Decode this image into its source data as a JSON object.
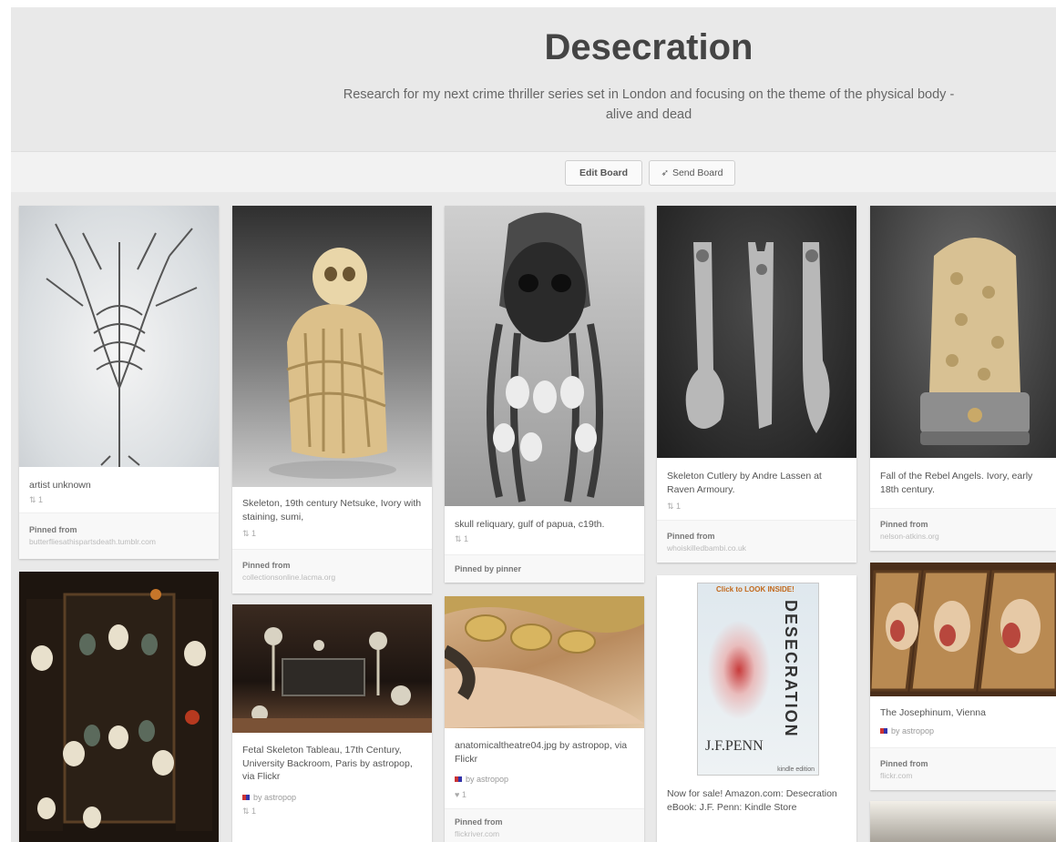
{
  "board": {
    "title": "Desecration",
    "description": "Research for my next crime thriller series set in London and focusing on the theme of the physical body - alive and dead",
    "edit_label": "Edit Board",
    "send_label": "Send Board"
  },
  "pins": [
    {
      "id": "p1",
      "desc": "artist unknown",
      "stats": "⇅ 1",
      "foot_label": "Pinned from",
      "foot_source": "butterfliesathispartsdeath.tumblr.com",
      "image": "tree-ribcage-illustration"
    },
    {
      "id": "p2",
      "desc": "Skeleton, 19th century Netsuke, Ivory with staining, sumi,",
      "stats": "⇅ 1",
      "foot_label": "Pinned from",
      "foot_source": "collectionsonline.lacma.org",
      "image": "ivory-netsuke-skeleton"
    },
    {
      "id": "p3",
      "desc": "skull reliquary, gulf of papua, c19th.",
      "stats": "⇅ 1",
      "foot_label": "Pinned by pinner",
      "foot_source": "",
      "image": "skull-reliquary"
    },
    {
      "id": "p4",
      "desc": "Skeleton Cutlery by Andre Lassen at Raven Armoury.",
      "stats": "⇅ 1",
      "foot_label": "Pinned from",
      "foot_source": "whoiskilledbambi.co.uk",
      "image": "skeleton-cutlery"
    },
    {
      "id": "p5",
      "desc": "Fall of the Rebel Angels. Ivory, early 18th century.",
      "stats": "",
      "foot_label": "Pinned from",
      "foot_source": "nelson-atkins.org",
      "image": "ivory-sculpture-dome"
    },
    {
      "id": "p6",
      "desc": "",
      "stats": "",
      "foot_label": "",
      "foot_source": "",
      "image": "skull-cabinet"
    },
    {
      "id": "p7",
      "desc": "Fetal Skeleton Tableau, 17th Century, University Backroom, Paris by astropop, via Flickr",
      "via": "by astropop",
      "stats": "⇅ 1",
      "foot_label": "",
      "foot_source": "",
      "image": "fetal-skeleton-tableau"
    },
    {
      "id": "p8",
      "desc": "anatomicaltheatre04.jpg by astropop, via Flickr",
      "via": "by astropop",
      "stats": "♥ 1",
      "foot_label": "Pinned from",
      "foot_source": "flickriver.com",
      "image": "anatomical-wax-model"
    },
    {
      "id": "p9",
      "desc": "Now for sale! Amazon.com: Desecration eBook: J.F. Penn: Kindle Store",
      "stats": "",
      "foot_label": "",
      "foot_source": "",
      "image": "book-cover",
      "book_title": "DESECRATION",
      "book_author": "J.F.PENN",
      "book_banner": "Click to LOOK INSIDE!",
      "book_edition": "kindle edition"
    },
    {
      "id": "p10",
      "desc": "The Josephinum, Vienna",
      "via": "by astropop",
      "stats": "",
      "foot_label": "Pinned from",
      "foot_source": "flickr.com",
      "image": "josephinum-wax-heads"
    },
    {
      "id": "p11",
      "desc": "",
      "stats": "",
      "foot_label": "",
      "foot_source": "",
      "image": "partial-image"
    }
  ],
  "colors": {
    "header_bg": "#e9e9e9",
    "title": "#444444",
    "feed_bg": "#e9e9e9"
  }
}
